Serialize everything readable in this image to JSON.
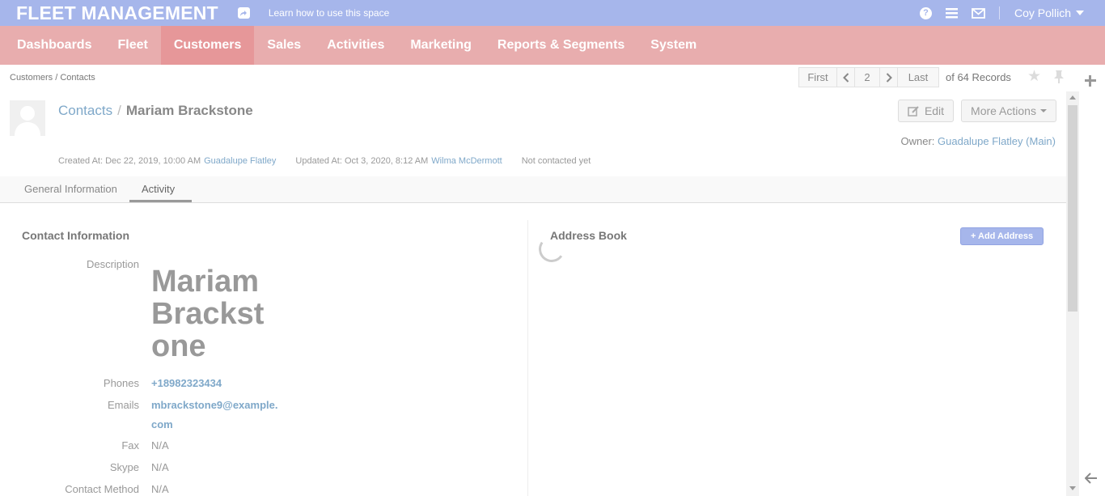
{
  "header": {
    "app_title": "FLEET MANAGEMENT",
    "learn_link": "Learn how to use this space",
    "user_name": "Coy Pollich"
  },
  "nav": {
    "items": [
      {
        "label": "Dashboards"
      },
      {
        "label": "Fleet"
      },
      {
        "label": "Customers",
        "active": true
      },
      {
        "label": "Sales"
      },
      {
        "label": "Activities"
      },
      {
        "label": "Marketing"
      },
      {
        "label": "Reports & Segments"
      },
      {
        "label": "System"
      }
    ]
  },
  "breadcrumb": "Customers / Contacts",
  "pager": {
    "first": "First",
    "current_page": "2",
    "last": "Last",
    "records": "of 64 Records"
  },
  "page": {
    "section": "Contacts",
    "separator": "/",
    "name": "Mariam Brackstone",
    "edit_label": "Edit",
    "more_actions_label": "More Actions",
    "owner_label": "Owner:",
    "owner_name": "Guadalupe Flatley",
    "owner_bu": "(Main)",
    "created_label": "Created At: Dec 22, 2019, 10:00 AM",
    "created_by": "Guadalupe Flatley",
    "updated_label": "Updated At: Oct 3, 2020, 8:12 AM",
    "updated_by": "Wilma McDermott",
    "contact_status": "Not contacted yet"
  },
  "tabs": [
    {
      "label": "General Information"
    },
    {
      "label": "Activity",
      "active": true
    }
  ],
  "contact_info": {
    "title": "Contact Information",
    "fields": [
      {
        "label": "Description",
        "value": "Mariam Brackstone"
      },
      {
        "label": "Phones",
        "value": "+18982323434"
      },
      {
        "label": "Emails",
        "value": "mbrackstone9@example.",
        "value_cont": "com"
      },
      {
        "label": "Fax",
        "value": "N/A"
      },
      {
        "label": "Skype",
        "value": "N/A"
      },
      {
        "label": "Contact Method",
        "value": "N/A"
      }
    ]
  },
  "address_book": {
    "title": "Address Book",
    "add_button": "+ Add Address"
  },
  "colors": {
    "topbar": "#a6b6eb",
    "nav": "#e8adae",
    "nav_active": "#e69799",
    "link": "#7fa8c9"
  }
}
